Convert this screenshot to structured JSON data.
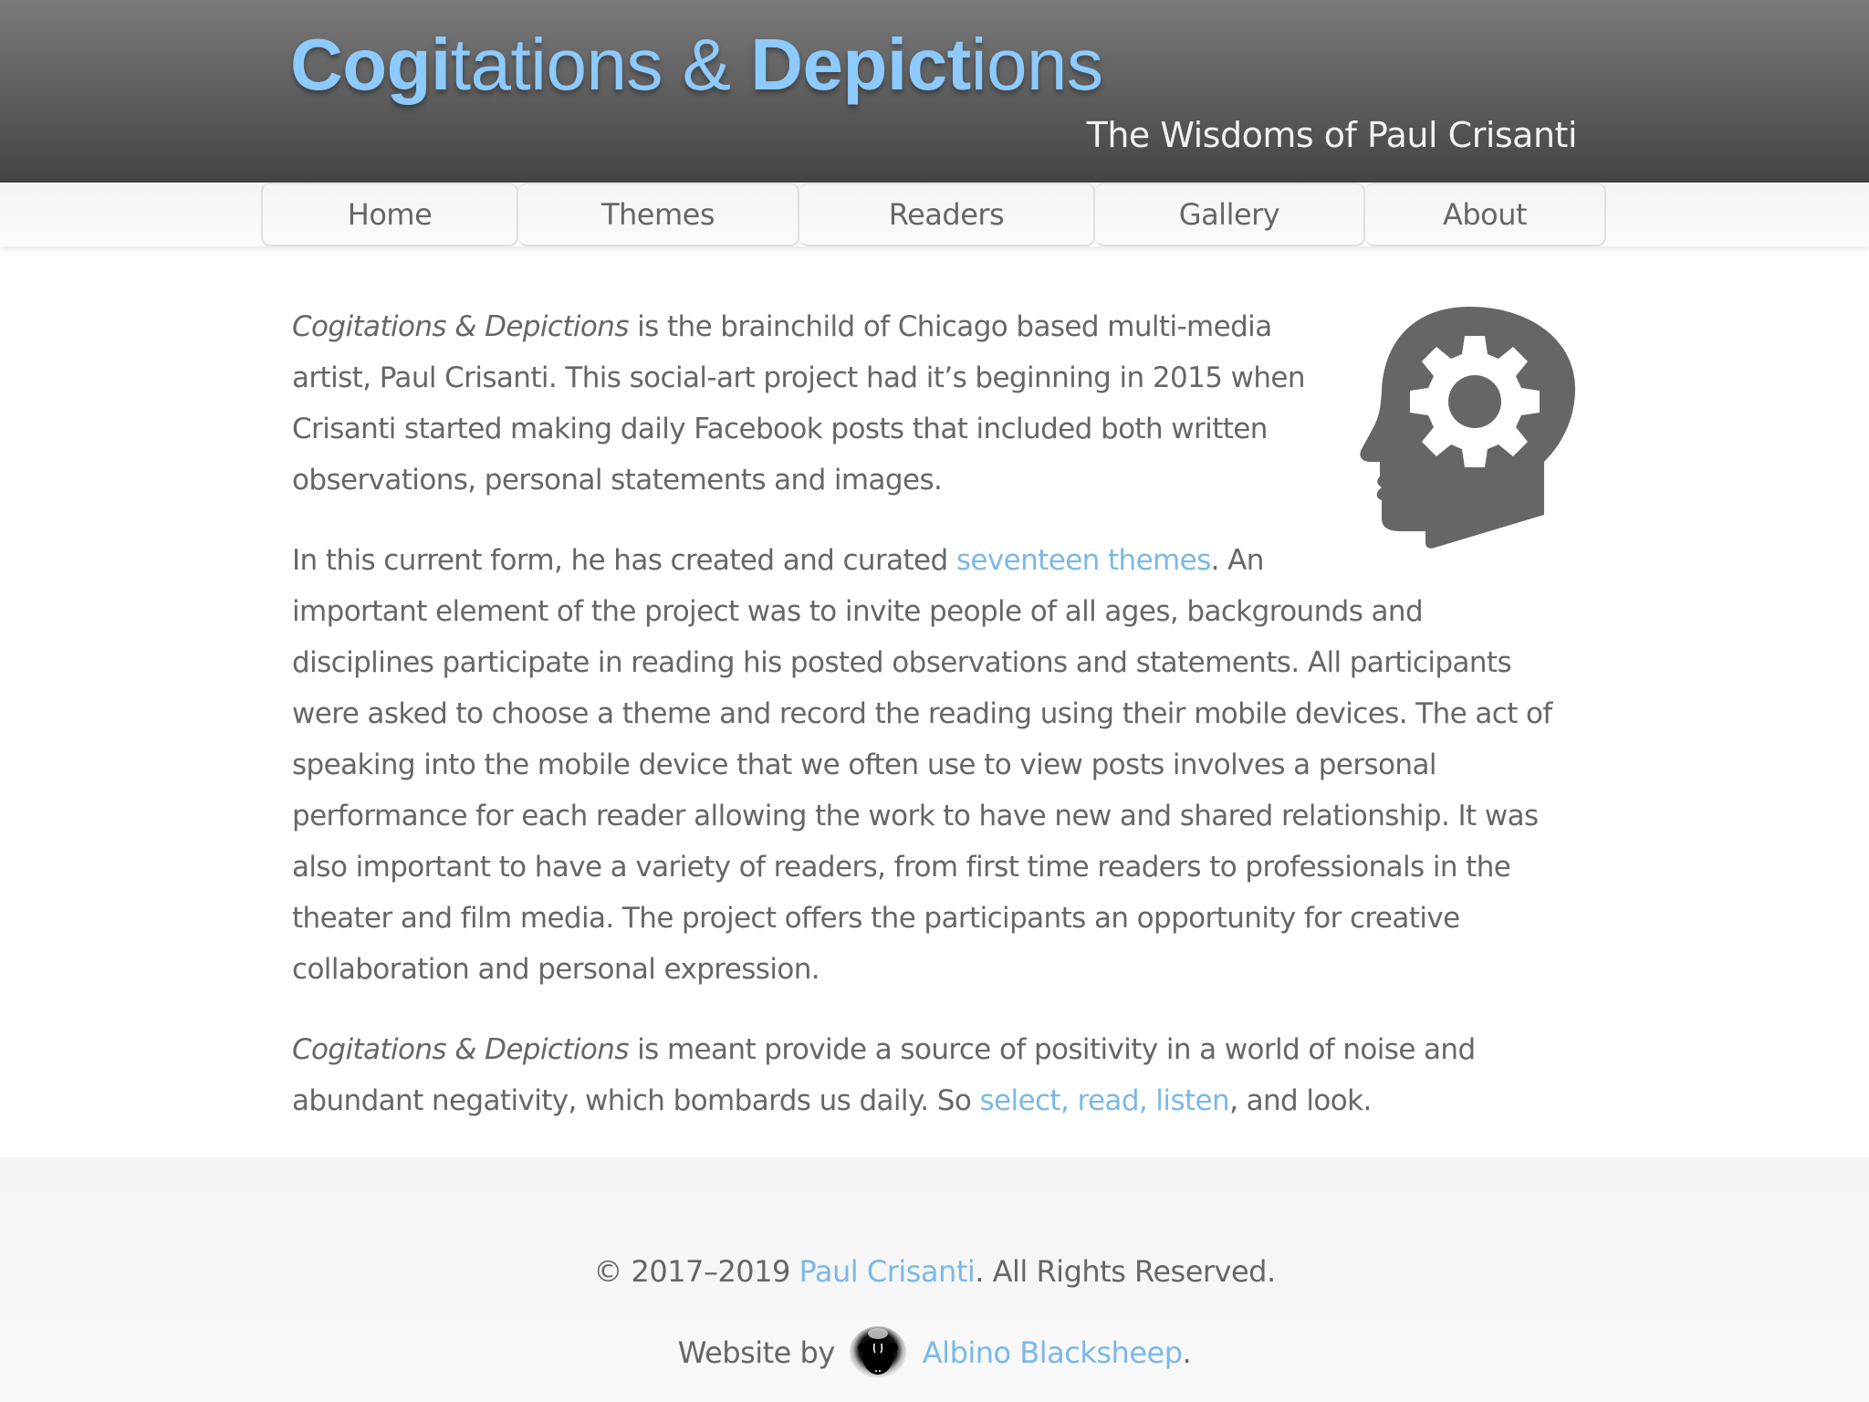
{
  "header": {
    "title_part1_bold": "Co",
    "title_part1_regular": "gi",
    "title_part1_rest": "tations & ",
    "title_part2_bold": "Depic",
    "title_part2_bold2": "t",
    "title_part2_rest": "ions",
    "title_full": "Cogitations & Depictions",
    "tagline": "The Wisdoms of Paul Crisanti",
    "title_color": "#8ccaff"
  },
  "nav": {
    "items": [
      {
        "label": "Home"
      },
      {
        "label": "Themes"
      },
      {
        "label": "Readers"
      },
      {
        "label": "Gallery"
      },
      {
        "label": "About"
      }
    ]
  },
  "content": {
    "icon": "head-gear-icon",
    "p1": {
      "em": "Cogitations & Depictions",
      "text": " is the brainchild of Chicago based multi-media artist, Paul Crisanti. This social-art project had it’s beginning in 2015 when Crisanti started making daily Facebook posts that included both written observations, personal statements and images."
    },
    "p2": {
      "before": "In this current form, he has created and curated ",
      "link": "seventeen themes",
      "after": ". An important element of the project was to invite people of all ages, backgrounds and disciplines participate in reading his posted observations and statements. All participants were asked to choose a theme and record the reading using their mobile devices. The act of speaking into the mobile device that we often use to view posts involves a personal performance for each reader allowing the work to have new and shared relationship. It was also important to have a variety of readers, from first time readers to professionals in the theater and film media. The project offers the participants an opportunity for creative collaboration and personal expression."
    },
    "p3": {
      "em": "Cogitations & Depictions",
      "before": " is meant provide a source of positivity in a world of noise and abundant negativity, which bombards us daily. So ",
      "link": "select, read, listen",
      "after": ", and look."
    },
    "link_color": "#7ab8e6",
    "text_color": "#666666"
  },
  "footer": {
    "copyright_prefix": "© 2017–2019 ",
    "copyright_link": "Paul Crisanti",
    "copyright_suffix": ". All Rights Reserved.",
    "credit_prefix": "Website by",
    "credit_logo": "black-sheep-logo",
    "credit_link": "Albino Blacksheep",
    "credit_suffix": "."
  }
}
